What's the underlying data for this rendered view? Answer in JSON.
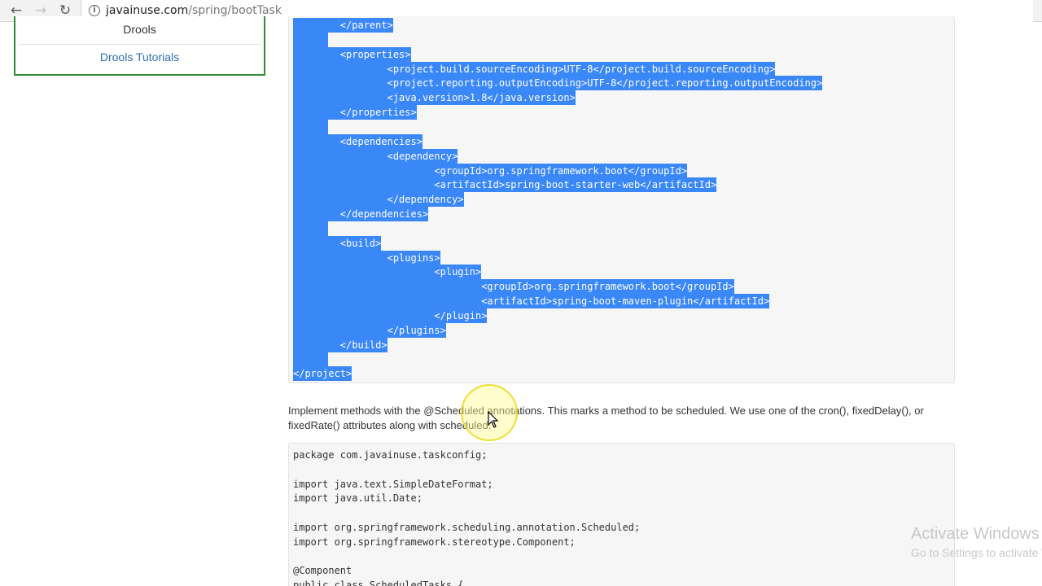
{
  "browser": {
    "url_domain": "javainuse.com",
    "url_path": "/spring/bootTask"
  },
  "sidebar": {
    "item_label": "Drools",
    "link_label": "Drools Tutorials"
  },
  "code_block_1": {
    "lines": [
      "        </parent>",
      "",
      "        <properties>",
      "                <project.build.sourceEncoding>UTF-8</project.build.sourceEncoding>",
      "                <project.reporting.outputEncoding>UTF-8</project.reporting.outputEncoding>",
      "                <java.version>1.8</java.version>",
      "        </properties>",
      "",
      "        <dependencies>",
      "                <dependency>",
      "                        <groupId>org.springframework.boot</groupId>",
      "                        <artifactId>spring-boot-starter-web</artifactId>",
      "                </dependency>",
      "        </dependencies>",
      "",
      "        <build>",
      "                <plugins>",
      "                        <plugin>",
      "                                <groupId>org.springframework.boot</groupId>",
      "                                <artifactId>spring-boot-maven-plugin</artifactId>",
      "                        </plugin>",
      "                </plugins>",
      "        </build>",
      "",
      "</project>"
    ]
  },
  "description": "Implement methods with the @Scheduled annotations. This marks a method to be scheduled. We use one of the cron(), fixedDelay(), or fixedRate() attributes along with scheduled.",
  "code_block_2": {
    "lines": [
      "package com.javainuse.taskconfig;",
      "",
      "import java.text.SimpleDateFormat;",
      "import java.util.Date;",
      "",
      "import org.springframework.scheduling.annotation.Scheduled;",
      "import org.springframework.stereotype.Component;",
      "",
      "@Component",
      "public class ScheduledTasks {"
    ]
  },
  "watermark": {
    "title": "Activate Windows",
    "subtitle": "Go to Settings to activate Windows."
  },
  "colors": {
    "selection": "#3a87f7",
    "sidebar_border": "#2e8b34",
    "link": "#2f6fb4"
  }
}
